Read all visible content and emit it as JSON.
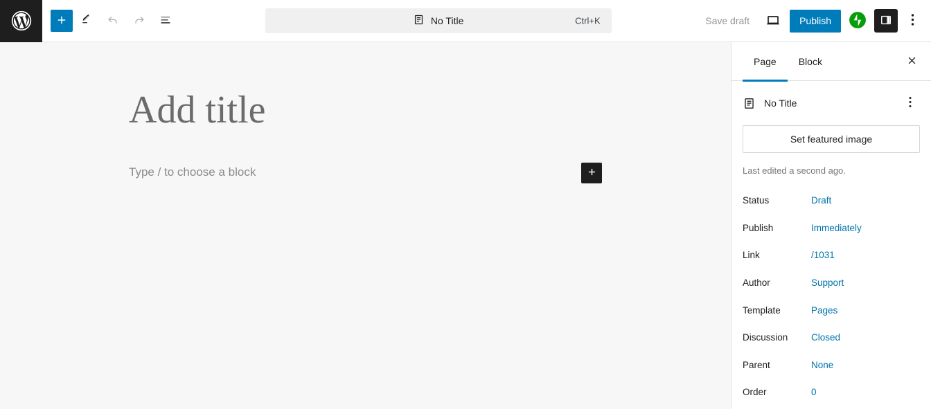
{
  "topbar": {
    "logo_icon": "wordpress-logo-icon",
    "add_block_label": "+",
    "add_block_icon": "plus-icon",
    "tools_icon": "pencil-edit-icon",
    "undo_icon": "undo-arrow-icon",
    "redo_icon": "redo-arrow-icon",
    "details_icon": "document-outline-icon",
    "command_bar": {
      "icon": "page-document-icon",
      "title": "No Title",
      "shortcut": "Ctrl+K"
    },
    "save_draft_label": "Save draft",
    "preview_icon": "desktop-preview-icon",
    "publish_label": "Publish",
    "jetpack_icon": "jetpack-icon",
    "sidebar_toggle_icon": "settings-sidebar-icon",
    "more_menu_icon": "three-dots-vertical-icon"
  },
  "canvas": {
    "title_placeholder": "Add title",
    "block_placeholder": "Type / to choose a block",
    "inserter_icon": "plus-icon"
  },
  "sidebar": {
    "tabs": [
      {
        "label": "Page",
        "active": true
      },
      {
        "label": "Block",
        "active": false
      }
    ],
    "close_icon": "close-icon",
    "document": {
      "icon": "page-document-icon",
      "name": "No Title",
      "menu_icon": "three-dots-vertical-icon"
    },
    "featured_image_label": "Set featured image",
    "last_edited": "Last edited a second ago.",
    "meta": [
      {
        "label": "Status",
        "value": "Draft"
      },
      {
        "label": "Publish",
        "value": "Immediately"
      },
      {
        "label": "Link",
        "value": "/1031"
      },
      {
        "label": "Author",
        "value": "Support"
      },
      {
        "label": "Template",
        "value": "Pages"
      },
      {
        "label": "Discussion",
        "value": "Closed"
      },
      {
        "label": "Parent",
        "value": "None"
      },
      {
        "label": "Order",
        "value": "0"
      }
    ]
  },
  "colors": {
    "accent_blue": "#007cba",
    "link_blue": "#0073aa",
    "dark": "#1e1e1e",
    "jetpack_green": "#069e08",
    "canvas_bg": "#f7f7f7"
  }
}
